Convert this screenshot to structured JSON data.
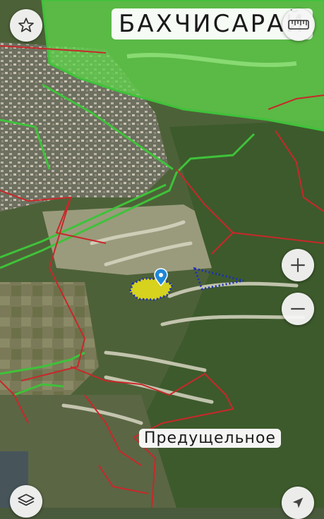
{
  "labels": {
    "city": "БАХЧИСАРАЙ",
    "village": "Предущельное"
  },
  "controls": {
    "favorite": "star-icon",
    "ruler": "ruler-icon",
    "zoom_in": "plus-icon",
    "zoom_out": "minus-icon",
    "layers": "layers-icon",
    "navigate": "navigation-arrow-icon"
  },
  "colors": {
    "protected_zone": "#5fd24a",
    "border_red": "#c8282a",
    "border_green": "#3fc23a",
    "parcel_fill": "#d6d21e",
    "parcel_outline": "#1a2fb8",
    "pin": "#1e88d8"
  }
}
